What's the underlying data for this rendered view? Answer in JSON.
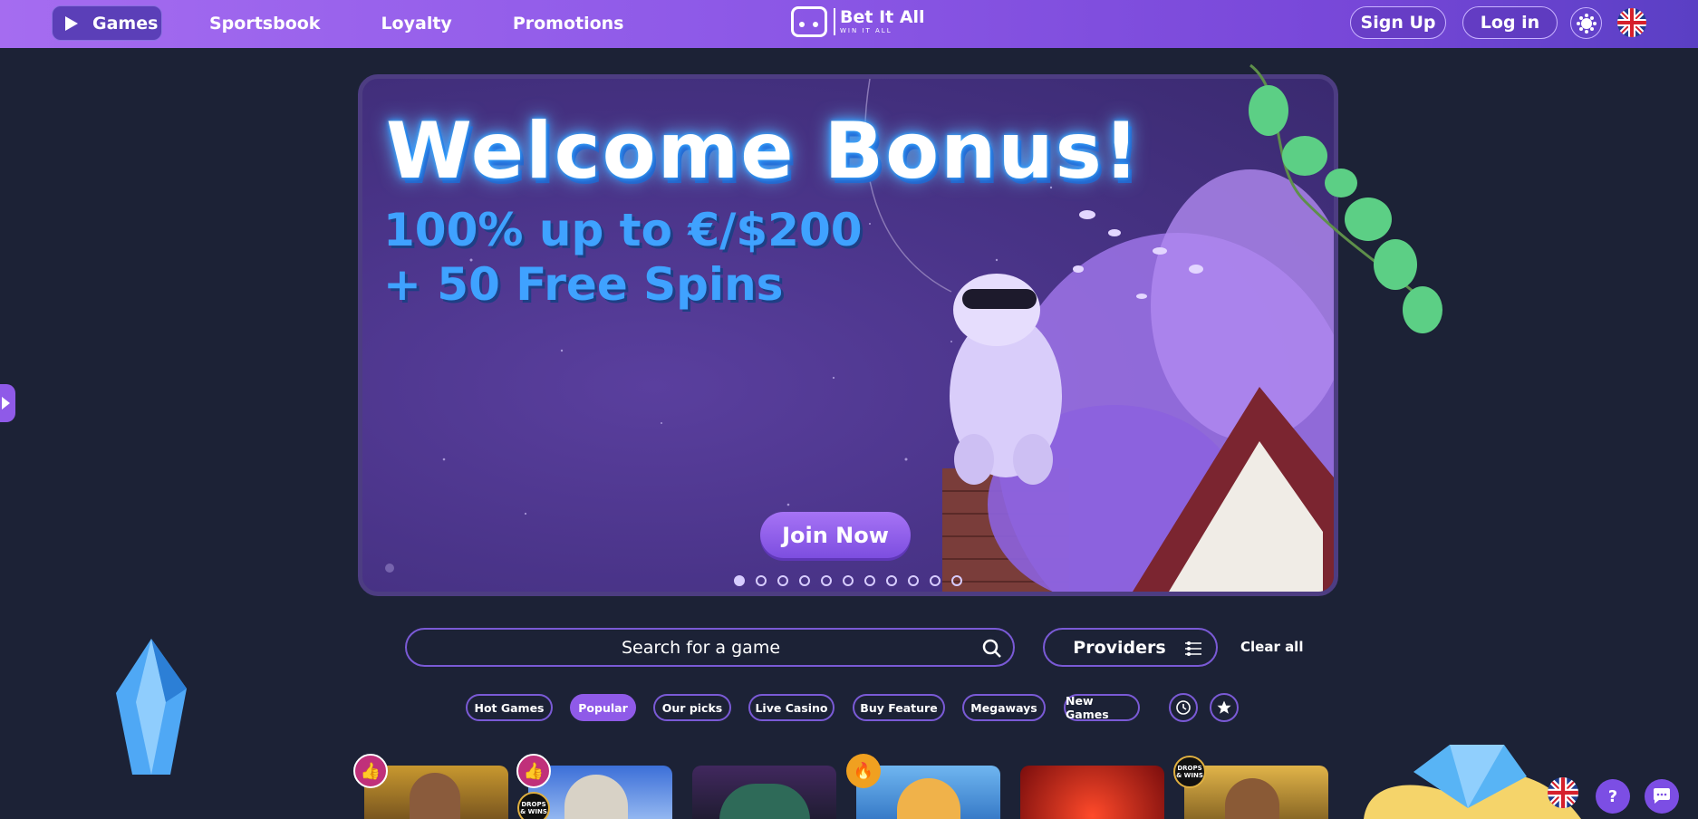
{
  "header": {
    "nav": [
      {
        "label": "Games",
        "active": true
      },
      {
        "label": "Sportsbook"
      },
      {
        "label": "Loyalty"
      },
      {
        "label": "Promotions"
      }
    ],
    "logo_title": "Bet It All",
    "logo_sub": "WIN IT ALL",
    "sign_up": "Sign Up",
    "log_in": "Log in",
    "theme_icon": "sun-icon",
    "language_icon": "uk-flag-icon"
  },
  "banner": {
    "title": "Welcome Bonus!",
    "line1": "100% up to €/$200",
    "line2": "+ 50 Free Spins",
    "cta": "Join Now",
    "slides_total": 11,
    "active_slide": 1
  },
  "search": {
    "placeholder": "Search for a game",
    "providers_label": "Providers",
    "clear_label": "Clear all"
  },
  "tags": [
    "Hot Games",
    "Popular",
    "Our picks",
    "Live Casino",
    "Buy Feature",
    "Megaways",
    "New Games"
  ],
  "active_tag": "Popular",
  "tile_badges": {
    "drops": "DROPS & WINS"
  },
  "colors": {
    "accent": "#8f5ae8",
    "background": "#1c2236",
    "banner_text": "#3fa2ff"
  }
}
